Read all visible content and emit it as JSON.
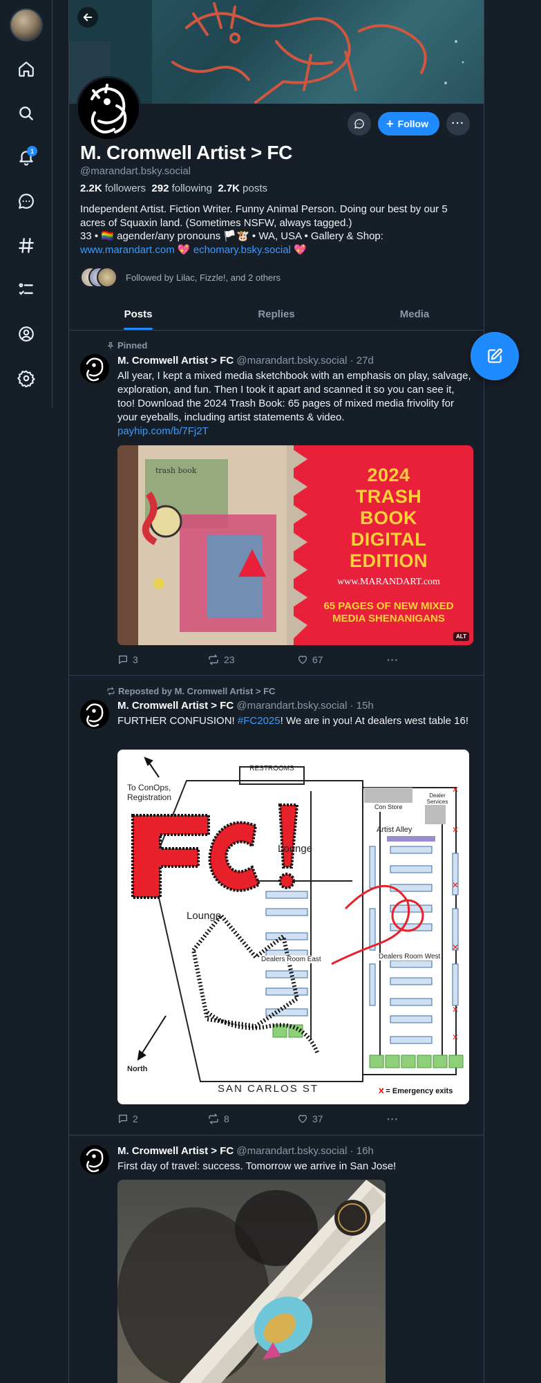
{
  "nav": {
    "notifications_count": "1",
    "icons": [
      "home-icon",
      "search-icon",
      "bell-icon",
      "chat-icon",
      "hashtag-icon",
      "list-icon",
      "profile-icon",
      "gear-icon"
    ]
  },
  "profile": {
    "display_name": "M. Cromwell Artist > FC",
    "handle": "@marandart.bsky.social",
    "followers_count": "2.2K",
    "followers_label": "followers",
    "following_count": "292",
    "following_label": "following",
    "posts_count": "2.7K",
    "posts_label": "posts",
    "bio_line1": "Independent Artist. Fiction Writer. Funny Animal Person. Doing our best by our 5 acres of Squaxin land. (Sometimes NSFW, always tagged.)",
    "bio_line2": "33 • 🏳️‍🌈 agender/any pronouns 🏳️🐮 • WA, USA • Gallery & Shop:",
    "link1": "www.marandart.com",
    "link2": "echomary.bsky.social",
    "heart": "💖",
    "followed_by": "Followed by Lilac, Fizzle!, and 2 others",
    "follow_label": "Follow"
  },
  "tabs": [
    "Posts",
    "Replies",
    "Media"
  ],
  "posts": [
    {
      "context": "Pinned",
      "author": "M. Cromwell Artist > FC",
      "handle": "@marandart.bsky.social",
      "time": "· 27d",
      "text": "All year, I kept a mixed media sketchbook with an emphasis on play, salvage, exploration, and fun. Then I took it apart and scanned it so you can see it, too! Download the 2024 Trash Book: 65 pages of mixed media frivolity for your eyeballs, including artist statements & video.",
      "link": "payhip.com/b/7Fj2T",
      "image": {
        "title_lines": [
          "2024",
          "TRASH",
          "BOOK",
          "DIGITAL",
          "EDITION"
        ],
        "url": "www.MARANDART.com",
        "sub_lines": [
          "65 PAGES OF NEW MIXED",
          "MEDIA SHENANIGANS"
        ],
        "alt_badge": "ALT",
        "book_label": "trash book"
      },
      "replies": "3",
      "reposts": "23",
      "likes": "67"
    },
    {
      "context": "Reposted by M. Cromwell Artist > FC",
      "author": "M. Cromwell Artist > FC",
      "handle": "@marandart.bsky.social",
      "time": "· 15h",
      "text_before": "FURTHER CONFUSION! ",
      "hashtag": "#FC2025",
      "text_after": "! We are in you! At dealers west table 16!",
      "map": {
        "restrooms": "RESTROOMS",
        "conops": "To ConOps, Registration",
        "con_store": "Con Store",
        "dealer_services": "Dealer Services",
        "artist_alley": "Artist Alley",
        "lounge_top": "Lounge",
        "lounge": "Lounge",
        "dealers_east": "Dealers Room East",
        "dealers_west": "Dealers Room West",
        "north": "North",
        "street": "SAN CARLOS ST",
        "emergency": "= Emergency exits",
        "fc_mark": "FC!"
      },
      "replies": "2",
      "reposts": "8",
      "likes": "37"
    },
    {
      "author": "M. Cromwell Artist > FC",
      "handle": "@marandart.bsky.social",
      "time": "· 16h",
      "text": "First day of travel: success. Tomorrow we arrive in San Jose!"
    }
  ],
  "colors": {
    "background": "#161e27",
    "accent": "#208bfe",
    "border": "#2e4052",
    "muted": "#8a98a8",
    "poster_red": "#e8203a",
    "poster_yellow": "#ffd23a"
  }
}
